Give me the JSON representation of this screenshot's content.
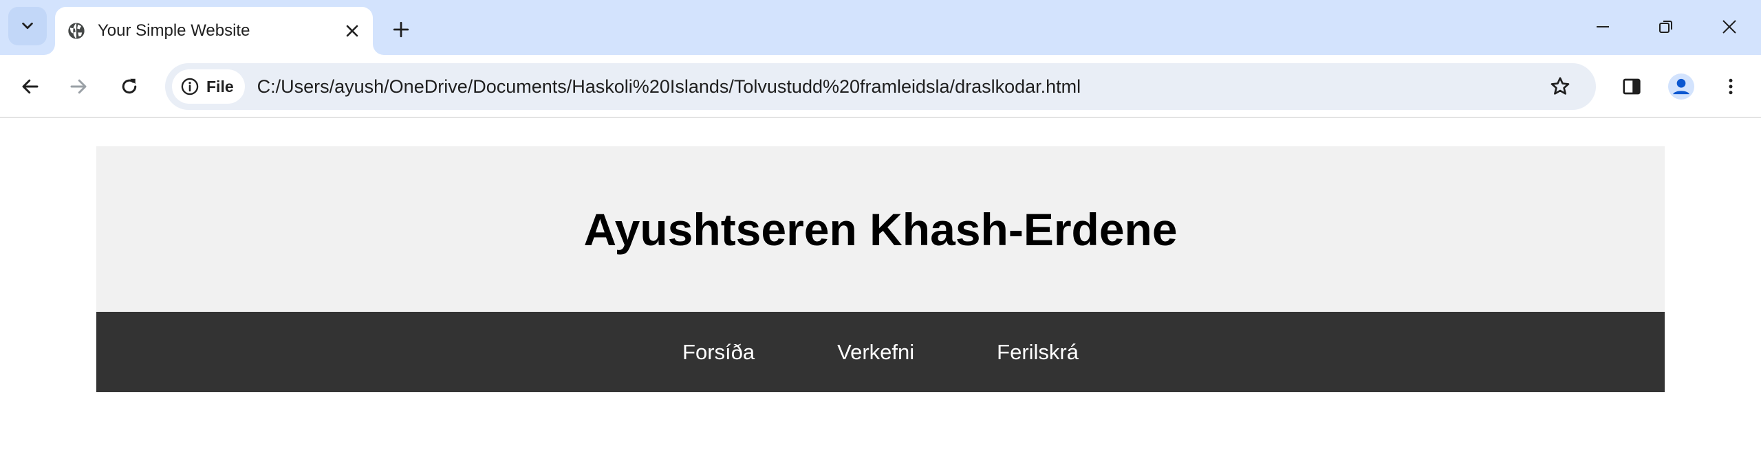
{
  "browser": {
    "tab": {
      "title": "Your Simple Website"
    },
    "omnibox": {
      "chip_label": "File",
      "url": "C:/Users/ayush/OneDrive/Documents/Haskoli%20Islands/Tolvustudd%20framleidsla/draslkodar.html"
    },
    "icons": {
      "tab_search": "chevron-down-icon",
      "favicon": "globe-icon",
      "close_tab": "close-icon",
      "new_tab": "plus-icon",
      "minimize": "minimize-icon",
      "restore": "restore-icon",
      "close_window": "close-icon",
      "back": "arrow-left-icon",
      "forward": "arrow-right-icon",
      "reload": "reload-icon",
      "info": "info-icon",
      "bookmark": "star-icon",
      "side_panel": "side-panel-icon",
      "profile": "profile-icon",
      "menu": "kebab-menu-icon"
    },
    "colors": {
      "tabstrip_bg": "#d3e3fd",
      "omnibox_bg": "#e9eef6",
      "profile_accent": "#0b57d0"
    }
  },
  "page": {
    "header": {
      "title": "Ayushtseren Khash-Erdene"
    },
    "nav": {
      "links": [
        {
          "label": "Forsíða"
        },
        {
          "label": "Verkefni"
        },
        {
          "label": "Ferilskrá"
        }
      ]
    },
    "colors": {
      "header_bg": "#f1f1f1",
      "nav_bg": "#333333",
      "nav_text": "#ffffff"
    }
  }
}
